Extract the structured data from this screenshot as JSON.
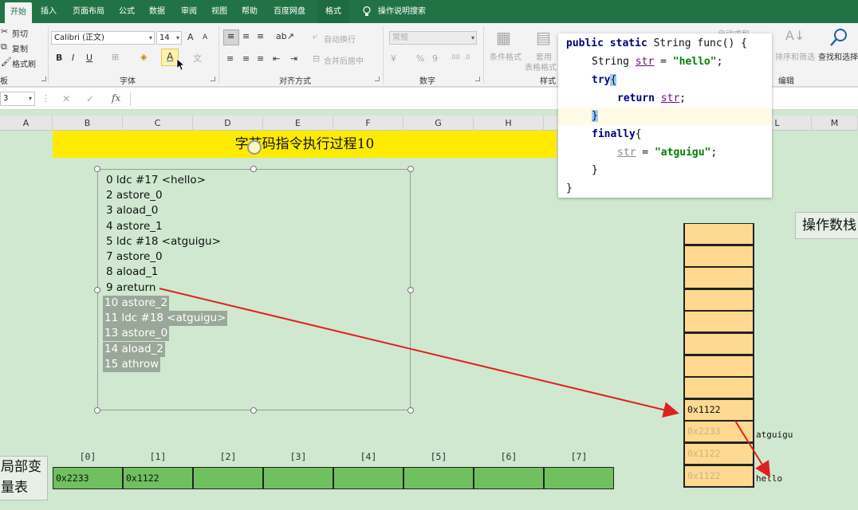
{
  "ribbon": {
    "tabs": [
      "开始",
      "插入",
      "页面布局",
      "公式",
      "数据",
      "审阅",
      "视图",
      "帮助",
      "百度网盘",
      "格式"
    ],
    "tell_me": "操作说明搜索",
    "clipboard": {
      "cut": "剪切",
      "copy": "复制",
      "format_painter": "格式刷",
      "group": "板"
    },
    "font": {
      "name": "Calibri (正文)",
      "size": "14",
      "bold": "B",
      "italic": "I",
      "underline": "U",
      "grow": "A",
      "shrink": "A",
      "group": "字体"
    },
    "alignment": {
      "wrap": "自动换行",
      "merge": "合并后居中",
      "group": "对齐方式"
    },
    "number": {
      "format": "常规",
      "percent": "%",
      "comma": "9",
      "group": "数字"
    },
    "styles": {
      "conditional": "条件格式",
      "table_line1": "套用",
      "table_line2": "表格格式",
      "group": "样式"
    },
    "editing": {
      "autosum": "自动求和",
      "sort_filter": "排序和筛选",
      "find_select": "查找和选择",
      "group": "编辑"
    }
  },
  "formula_bar": {
    "name_box": "3",
    "cancel": "✕",
    "enter": "✓",
    "fx": "fx"
  },
  "columns": [
    "A",
    "B",
    "C",
    "D",
    "E",
    "F",
    "G",
    "H",
    "L",
    "M"
  ],
  "sheet": {
    "title": "字节码指令执行过程10",
    "instructions": [
      "0 ldc #17 <hello>",
      "2 astore_0",
      "3 aload_0",
      "4 astore_1",
      "5 ldc #18 <atguigu>",
      "7 astore_0",
      "8 aload_1",
      "9 areturn"
    ],
    "highlighted_instructions": [
      "10 astore_2",
      "11 ldc #18 <atguigu>",
      "13 astore_0",
      "14 aload_2",
      "15 athrow"
    ]
  },
  "source_code": {
    "kw_public": "public",
    "kw_static": "static",
    "sig_rest": " String func() {",
    "line2_type": "String ",
    "line2_var": "str",
    "line2_eq": " = ",
    "line2_val": "\"hello\"",
    "line2_end": ";",
    "kw_try": "try",
    "brace_open": "{",
    "kw_return": "return",
    "line4_var": "str",
    "semicolon": ";",
    "brace_close": "}",
    "kw_finally": "finally",
    "line7_var": "str",
    "line7_eq": " = ",
    "line7_val": "\"atguigu\"",
    "line7_end": ";",
    "close1": "}",
    "close2": "}"
  },
  "operand_stack": {
    "label": "操作数栈",
    "cells": [
      "",
      "",
      "",
      "",
      "",
      "",
      "",
      "",
      "0x1122",
      "0x2233",
      "0x1122",
      "0x1122"
    ],
    "faded": [
      false,
      false,
      false,
      false,
      false,
      false,
      false,
      false,
      false,
      true,
      true,
      true
    ],
    "notes": [
      "atguigu",
      "hello"
    ]
  },
  "local_vars": {
    "label_line1": "局部变",
    "label_line2": "量表",
    "indices": [
      "[0]",
      "[1]",
      "[2]",
      "[3]",
      "[4]",
      "[5]",
      "[6]",
      "[7]"
    ],
    "values": [
      "0x2233",
      "0x1122",
      "",
      "",
      "",
      "",
      "",
      ""
    ]
  },
  "colors": {
    "ribbon_green": "#217346",
    "title_yellow": "#ffeb00",
    "stack_fill": "#ffd990",
    "local_fill": "#70c060",
    "arrow_red": "#e02020"
  }
}
